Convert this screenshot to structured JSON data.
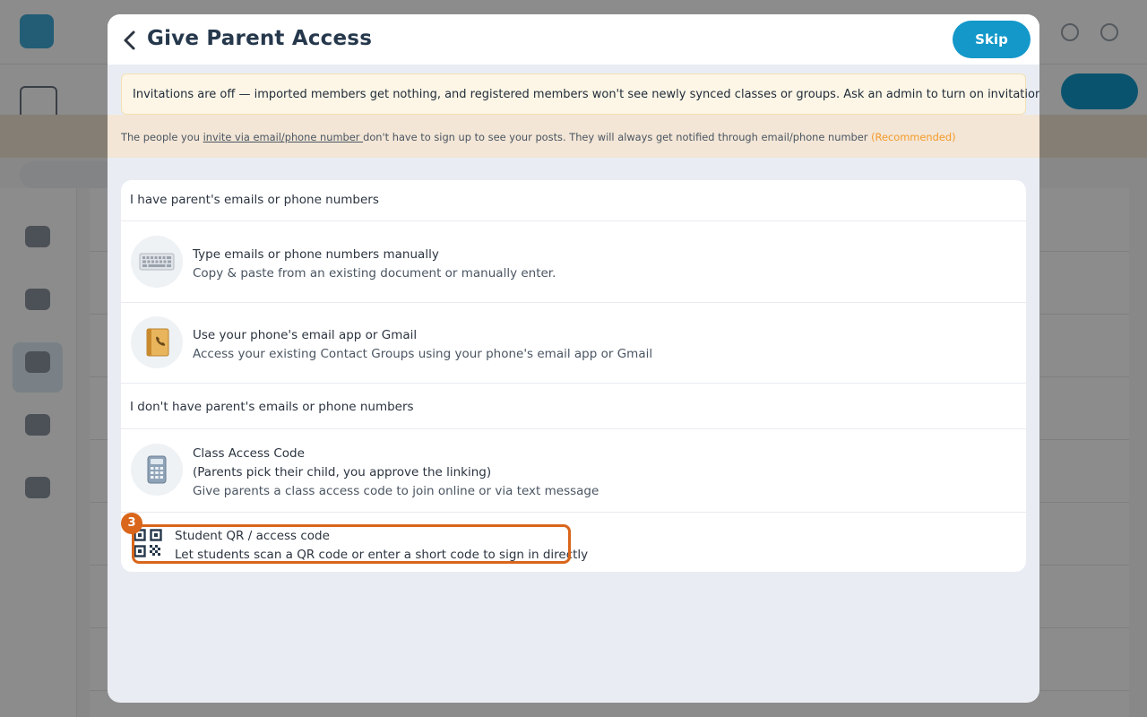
{
  "modal": {
    "title": "Give Parent Access",
    "skip_label": "Skip"
  },
  "invite_alert": {
    "text": "Invitations are off — imported members get nothing, and registered members won't see newly synced classes or groups. Ask an admin to turn on invitations."
  },
  "info_strip": {
    "prefix": "The people you ",
    "link": "invite via email/phone number ",
    "suffix": "don't have to sign up to see your posts. They will always get notified through email/phone number ",
    "recommended": "(Recommended)"
  },
  "sections": {
    "have_contacts": "I have parent's emails or phone numbers",
    "no_contacts": "I don't have parent's emails or phone numbers"
  },
  "options": {
    "manual": {
      "title": "Type emails or phone numbers manually",
      "desc": "Copy & paste from an existing document or manually enter.",
      "icon": "keyboard-icon"
    },
    "phone_app": {
      "title": "Use your phone's email app or Gmail",
      "desc": "Access your existing Contact Groups using your phone's email app or Gmail",
      "icon": "contact-book-icon"
    },
    "class_code": {
      "title": "Class Access Code",
      "line2": "(Parents pick their child, you approve the linking)",
      "line3": "Give parents a class access code to join online or via text message",
      "icon": "calculator-icon"
    },
    "student_qr": {
      "title": "Student QR / access code",
      "desc": "Let students scan a QR code or enter a short code to sign in directly",
      "icon": "qr-code-icon"
    }
  },
  "step_badge": "3",
  "colors": {
    "accent": "#1398c9",
    "highlight": "#d9661b",
    "recommended": "#f39a2a"
  }
}
